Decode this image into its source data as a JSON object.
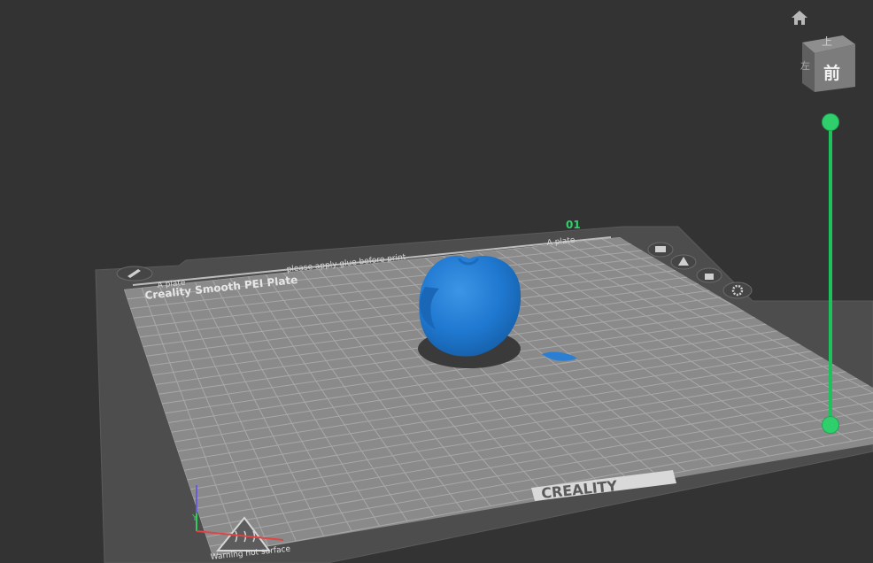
{
  "scene": {
    "background_color": "#333334",
    "plate_number": "01",
    "plate_name": "Creality Smooth PEI Plate",
    "plate_side_label": "A plate",
    "plate_side_label_right": "A plate",
    "plate_instruction": "please apply glue before print",
    "warning_text": "Warning hot surface",
    "brand_logo": "CREALITY",
    "model_color": "#2b82d4"
  },
  "plate_tools": {
    "edit_icon": "pencil-icon",
    "arrange_icon": "arrange-icon",
    "orient_icon": "auto-orient-icon",
    "lock_icon": "lock-icon",
    "settings_icon": "gear-icon"
  },
  "view_cube": {
    "top_label": "上",
    "front_label": "前",
    "side_label": "左",
    "home_icon": "home-icon"
  },
  "layer_slider": {
    "color": "#1ec25c",
    "top_fraction": 1.0,
    "bottom_fraction": 0.0
  }
}
